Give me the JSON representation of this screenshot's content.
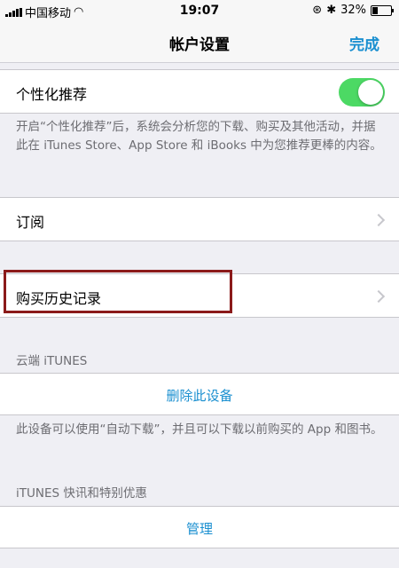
{
  "status": {
    "carrier": "中国移动",
    "time": "19:07",
    "battery": "32%",
    "battery_level": 0.32
  },
  "nav": {
    "title": "帐户设置",
    "done": "完成"
  },
  "personalized": {
    "label": "个性化推荐",
    "enabled": true,
    "description": "开启“个性化推荐”后，系统会分析您的下载、购买及其他活动，并据此在 iTunes Store、App Store 和 iBooks 中为您推荐更棒的内容。"
  },
  "subscriptions": {
    "label": "订阅"
  },
  "purchase_history": {
    "label": "购买历史记录"
  },
  "cloud": {
    "header": "云端 iTUNES",
    "remove_device": "删除此设备",
    "description": "此设备可以使用“自动下载”，并且可以下载以前购买的 App 和图书。"
  },
  "news": {
    "header": "iTUNES 快讯和特别优惠",
    "manage": "管理"
  },
  "colors": {
    "accent": "#1a8fd0",
    "toggle_on": "#4cd964",
    "highlight_box": "#8b1a1a"
  }
}
